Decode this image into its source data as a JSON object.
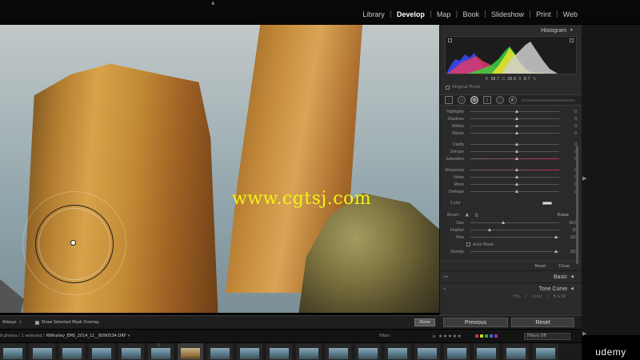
{
  "modules": [
    "Library",
    "Develop",
    "Map",
    "Book",
    "Slideshow",
    "Print",
    "Web"
  ],
  "active_module": "Develop",
  "watermark": "www.cgtsj.com",
  "histogram": {
    "title": "Histogram",
    "r_label": "R",
    "r_value": "38.7",
    "g_label": "G",
    "g_value": "26.9",
    "b_label": "B",
    "b_value": "8.7",
    "unit": "%",
    "original_photo_label": "Original Photo"
  },
  "adjustments_tone": [
    {
      "label": "Highlights",
      "value": "0"
    },
    {
      "label": "Shadows",
      "value": "0"
    },
    {
      "label": "Whites",
      "value": "0"
    },
    {
      "label": "Blacks",
      "value": "0"
    }
  ],
  "adjustments_presence": [
    {
      "label": "Clarity",
      "value": "0"
    },
    {
      "label": "Dehaze",
      "value": "0"
    },
    {
      "label": "Saturation",
      "value": "0"
    }
  ],
  "adjustments_detail": [
    {
      "label": "Sharpness",
      "value": "0"
    },
    {
      "label": "Noise",
      "value": "0"
    },
    {
      "label": "Moiré",
      "value": "0"
    },
    {
      "label": "Defringe",
      "value": "0"
    }
  ],
  "color_label": "Color",
  "brush": {
    "label": "Brush :",
    "a_label": "A",
    "b_label": "B",
    "erase_label": "Erase",
    "settings": [
      {
        "label": "Size",
        "value": "34.8",
        "level": 0.35
      },
      {
        "label": "Feather",
        "value": "20",
        "level": 0.2
      },
      {
        "label": "Flow",
        "value": "100",
        "level": 0.95
      }
    ],
    "auto_mask_label": "Auto Mask",
    "density": {
      "label": "Density",
      "value": "100",
      "level": 0.95
    }
  },
  "panel_buttons": {
    "reset": "Reset",
    "close": "Close"
  },
  "sections": [
    {
      "label": "Basic"
    },
    {
      "label": "Tone Curve"
    }
  ],
  "hsl_tabs": [
    "HSL",
    "Color",
    "B & W"
  ],
  "toolbar": {
    "overlay_mode": "Always",
    "show_overlay_label": "Show Selected Mask Overlay",
    "done_label": "Done",
    "previous_label": "Previous",
    "reset_label": "Reset"
  },
  "filmbar": {
    "count_text": "9 photos / 1 selected /",
    "path_text": "RWhalley_EMS_2014_11__B090534.ORF",
    "filter_label": "Filter :",
    "filters_off_label": "Filters Off"
  },
  "thumb_selected_number": "2",
  "brand": "udemy",
  "colors": {
    "accent_watermark": "#f2f21a",
    "panel_bg": "#2a2a2a",
    "app_bg": "#000000"
  }
}
